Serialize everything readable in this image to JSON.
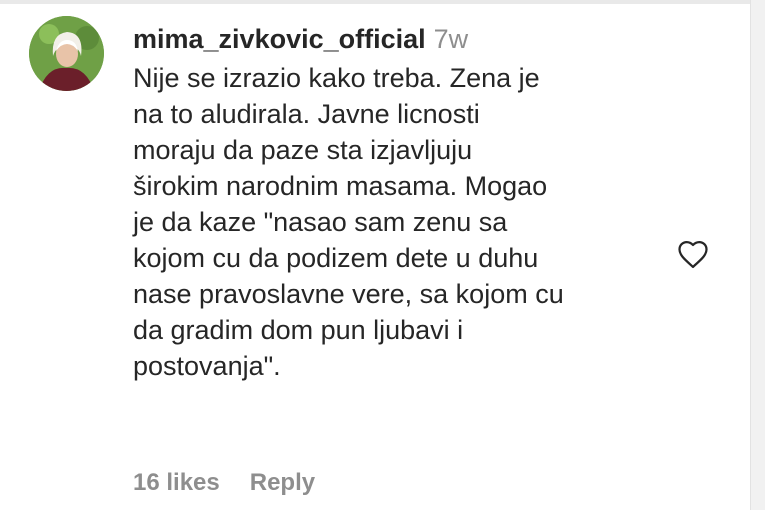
{
  "comment": {
    "username": "mima_zivkovic_official",
    "time": "7w",
    "lines": [
      "Nije se izrazio kako treba. Zena je",
      "na to aludirala. Javne licnosti",
      "moraju da paze sta izjavljuju",
      "širokim narodnim masama. Mogao",
      "je da kaze \"nasao sam zenu sa",
      "kojom cu da podizem dete u duhu",
      "nase pravoslavne vere, sa kojom cu",
      "da gradim dom pun ljubavi i",
      "postovanja\"."
    ],
    "likes": "16 likes",
    "reply": "Reply"
  },
  "icons": {
    "avatar": "profile-photo",
    "like": "heart-outline-icon"
  },
  "colors": {
    "text": "#262626",
    "secondary": "#8e8e8e",
    "avatar_bg": "#6fa046"
  }
}
